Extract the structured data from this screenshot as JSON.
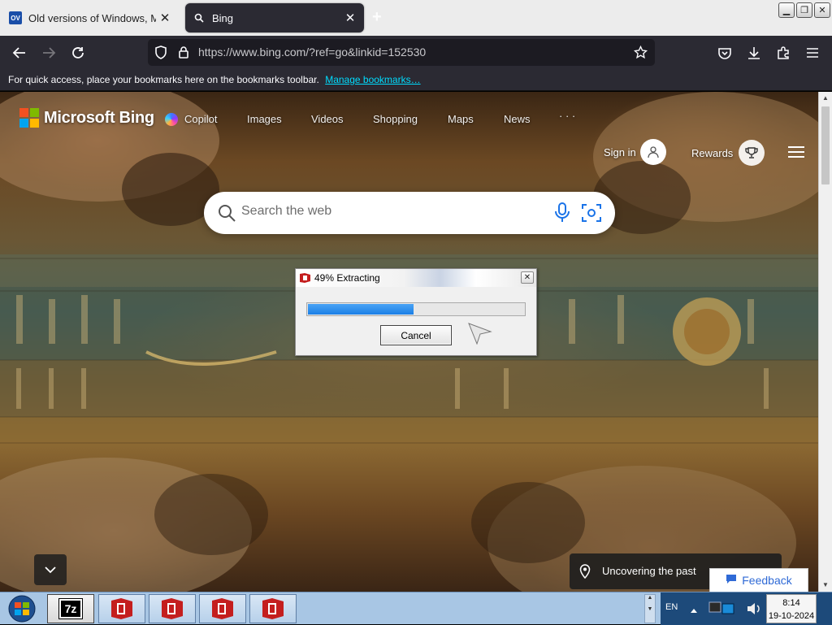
{
  "browser": {
    "tabs": [
      {
        "favicon": "OV",
        "title": "Old versions of Windows, Mac",
        "active": false
      },
      {
        "favicon": "search-icon",
        "title": "Bing",
        "active": true
      }
    ],
    "new_tab": "+",
    "url": "https://www.bing.com/?ref=go&linkid=152530",
    "bookmarks_message": "For quick access, place your bookmarks here on the bookmarks toolbar.",
    "bookmarks_link": "Manage bookmarks…"
  },
  "bing": {
    "logo_text": "Microsoft Bing",
    "logo_colors": [
      "#f25022",
      "#7fba00",
      "#00a4ef",
      "#ffb900"
    ],
    "nav": [
      "Copilot",
      "Images",
      "Videos",
      "Shopping",
      "Maps",
      "News",
      "· · ·"
    ],
    "sign_in": "Sign in",
    "rewards": "Rewards",
    "search_placeholder": "Search the web",
    "location_caption": "Uncovering the past",
    "feedback": "Feedback"
  },
  "dialog": {
    "title": "49% Extracting",
    "progress_fraction": 0.49,
    "cancel_label": "Cancel",
    "progress_color": "#1b7fe6"
  },
  "taskbar": {
    "app_7z": "7z",
    "tray_lang": "EN",
    "time": "8:14",
    "date": "19-10-2024"
  }
}
